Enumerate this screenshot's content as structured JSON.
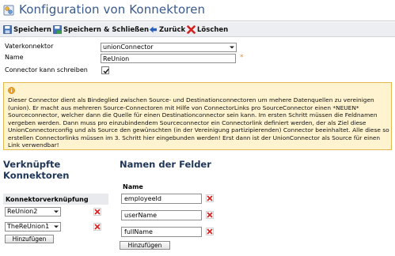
{
  "header": {
    "title": "Konfiguration von Konnektoren"
  },
  "toolbar": {
    "save": "Speichern",
    "save_close": "Speichern & Schließen",
    "back": "Zurück",
    "delete": "Löschen"
  },
  "form": {
    "vaterkonnektor_label": "Vaterkonnektor",
    "vaterkonnektor_value": "unionConnector",
    "name_label": "Name",
    "name_value": "ReUnion",
    "write_label": "Connector kann schreiben",
    "write_checked": true
  },
  "info": {
    "text": "Dieser Connector dient als Bindeglied zwischen Source- und Destinationconnectoren um mehere Datenquellen zu vereinigen (union). Er macht aus mehreren Source-Connectoren mit Hilfe von ConnectorLinks pro SourceConnector einen *NEUEN* Sourceconnector, welcher dann die Quelle für einen Destinationconnector sein kann. Im ersten Schritt müssen die Feldnamen vergeben werden. Dann muss pro einzubindendem Sourceconnector ein Connectorlink definiert werden, der als Ziel diese UnionConnectorconfig und als Source den gewünschten (in der Vereinigung partizipierenden) Connector beeinhaltet. Alle diese so erstellen Connectorlinks müssen im 3. Schritt hier eingebunden werden! Erst dann ist der UnionConnector als Source für einen Link verwendbar!"
  },
  "links": {
    "title": "Verknüpfte Konnektoren",
    "column": "Konnektorverknüpfung",
    "items": [
      "ReUnion2",
      "TheReUnion1"
    ],
    "add": "Hinzufügen"
  },
  "fields": {
    "title": "Namen der Felder",
    "column": "Name",
    "items": [
      "employeeId",
      "userName",
      "fullName"
    ],
    "add": "Hinzufügen"
  },
  "colors": {
    "title": "#3a5a8c",
    "section": "#1f3557",
    "info_bg": "#fff4cf",
    "info_border": "#e3b84f",
    "required": "#f08a24",
    "delete": "#d42020"
  }
}
